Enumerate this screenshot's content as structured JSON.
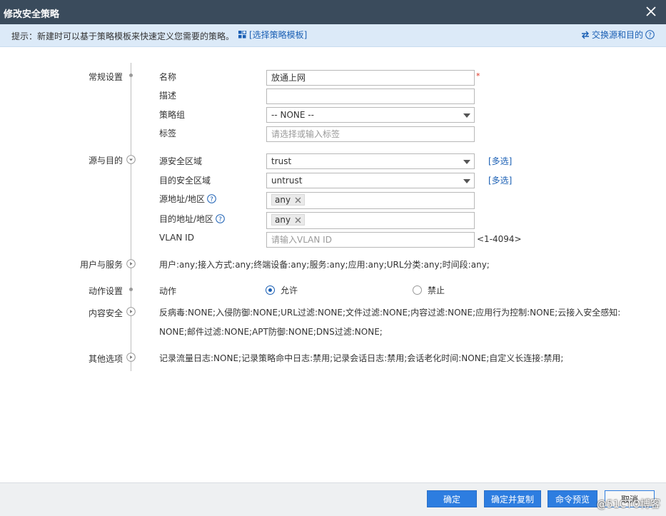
{
  "dialog": {
    "title": "修改安全策略",
    "close_icon": "close-icon"
  },
  "hint": {
    "text": "提示：新建时可以基于策略模板来快速定义您需要的策略。",
    "template_link": "[选择策略模板]",
    "swap_link": "交换源和目的"
  },
  "sections": {
    "general": "常规设置",
    "src_dst": "源与目的",
    "user_service": "用户与服务",
    "action": "动作设置",
    "content": "内容安全",
    "other": "其他选项"
  },
  "general": {
    "name_label": "名称",
    "name_value": "放通上网",
    "required_mark": "*",
    "desc_label": "描述",
    "desc_value": "",
    "group_label": "策略组",
    "group_value": "-- NONE --",
    "tag_label": "标签",
    "tag_placeholder": "请选择或输入标签"
  },
  "src_dst": {
    "src_zone_label": "源安全区域",
    "src_zone_value": "trust",
    "dst_zone_label": "目的安全区域",
    "dst_zone_value": "untrust",
    "multi_select": "[多选]",
    "src_addr_label": "源地址/地区",
    "src_addr_tag": "any",
    "dst_addr_label": "目的地址/地区",
    "dst_addr_tag": "any",
    "vlan_label": "VLAN ID",
    "vlan_placeholder": "请输入VLAN ID",
    "vlan_range": "<1-4094>"
  },
  "user_service": {
    "summary": "用户:any;接入方式:any;终端设备:any;服务:any;应用:any;URL分类:any;时间段:any;"
  },
  "action": {
    "label": "动作",
    "allow": "允许",
    "deny": "禁止",
    "selected": "allow"
  },
  "content": {
    "line1": "反病毒:NONE;入侵防御:NONE;URL过滤:NONE;文件过滤:NONE;内容过滤:NONE;应用行为控制:NONE;云接入安全感知:",
    "line2": "NONE;邮件过滤:NONE;APT防御:NONE;DNS过滤:NONE;"
  },
  "other": {
    "summary": "记录流量日志:NONE;记录策略命中日志:禁用;记录会话日志:禁用;会话老化时间:NONE;自定义长连接:禁用;"
  },
  "footer": {
    "ok": "确定",
    "ok_copy": "确定并复制",
    "preview": "命令预览",
    "cancel": "取消",
    "watermark": "@51CTO博客"
  },
  "colors": {
    "titlebar": "#3a4b5c",
    "hintbar": "#dceaf8",
    "link": "#1a5fb4",
    "primary_button": "#2d7de0"
  }
}
